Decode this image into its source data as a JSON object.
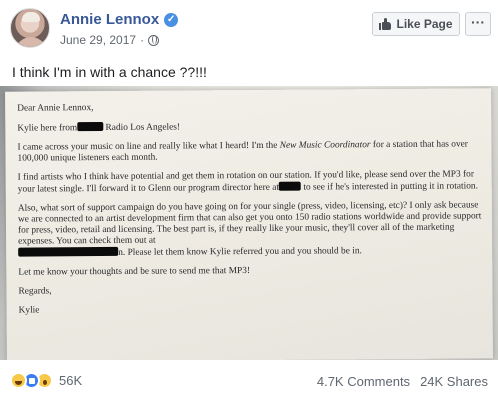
{
  "header": {
    "page_name": "Annie Lennox",
    "verified_icon": "verified-check-icon",
    "date": "June 29, 2017",
    "separator": "·",
    "privacy_icon": "globe-icon",
    "like_page_label": "Like Page",
    "more_label": "···"
  },
  "post": {
    "text": "I think I'm in with a chance ??!!!"
  },
  "letter": {
    "greeting": "Dear Annie Lennox,",
    "intro_before": "Kylie here from",
    "intro_after": " Radio Los Angeles!",
    "p1a": "I came across your music on line and really like what I heard! I'm the ",
    "p1_role": "New Music Coordinator",
    "p1b": " for a station that has over 100,000 unique listeners each month.",
    "p2a": "I find artists who I think have potential and get them in rotation on our station. If you'd like, please send over the MP3 for your latest single.  I'll forward it to Glenn our program director here at",
    "p2b": " to see if he's interested in putting it in rotation.",
    "p3a": "Also, what sort of support campaign do you have going on for your single (press, video, licensing, etc)?  I only ask because we are connected to an artist development firm that can also get you onto 150 radio stations worldwide and provide support for press, video, retail and licensing. The best part is, if they really like your music, they'll cover all of the marketing expenses. You can check them out at",
    "p3b": "n. Please let them know Kylie referred you and you should be in.",
    "p4": "Let me know your thoughts and be sure to send me that MP3!",
    "closing": "Regards,",
    "signature": "Kylie"
  },
  "footer": {
    "reaction_icons": [
      "haha-reaction-icon",
      "like-reaction-icon",
      "wow-reaction-icon"
    ],
    "reaction_count": "56K",
    "comments": "4.7K Comments",
    "shares": "24K Shares"
  },
  "colors": {
    "link": "#385898",
    "meta": "#616770",
    "verified": "#4a90e2"
  }
}
